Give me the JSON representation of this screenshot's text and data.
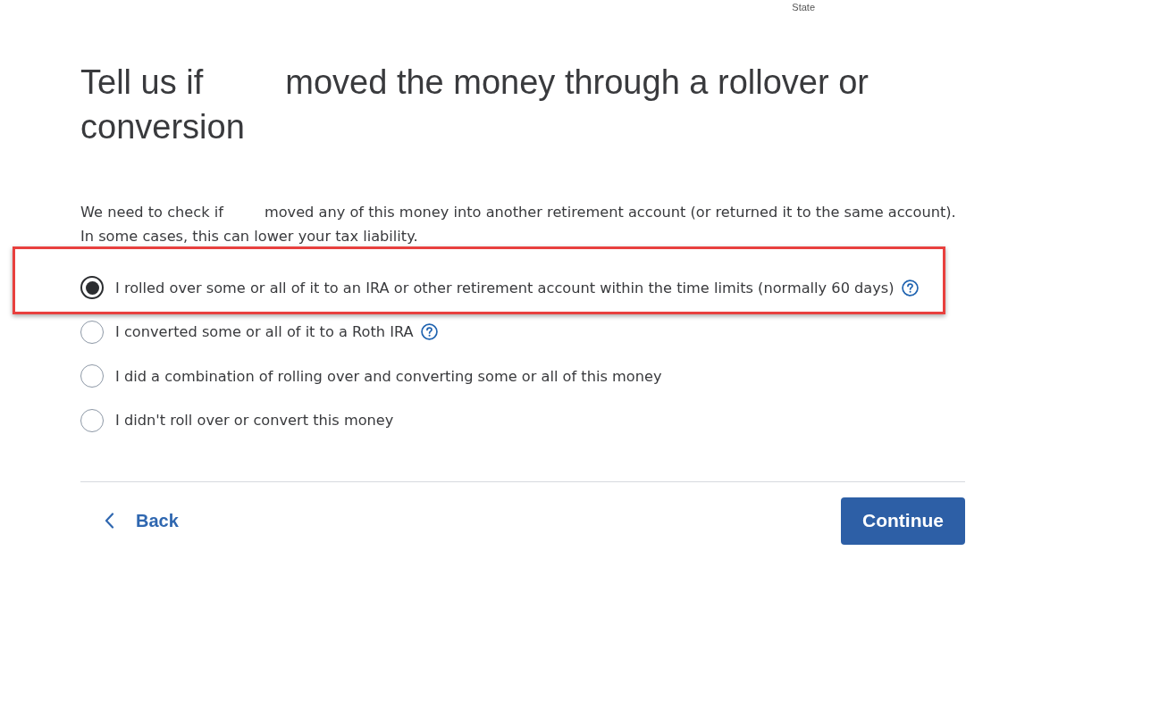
{
  "header": {
    "label": "State"
  },
  "heading": {
    "before_gap": "Tell us if",
    "after_gap": "moved the money through a rollover or conversion"
  },
  "description": {
    "before_gap": "We need to check if",
    "after_gap": "moved any of this money into another retirement account (or returned it to the same account). In some cases, this can lower your tax liability."
  },
  "options": [
    {
      "label": "I rolled over some or all of it to an IRA or other retirement account within the time limits (normally 60 days)",
      "selected": true,
      "help": true,
      "highlighted": true
    },
    {
      "label": "I converted some or all of it to a Roth IRA",
      "selected": false,
      "help": true,
      "highlighted": false
    },
    {
      "label": "I did a combination of rolling over and converting some or all of this money",
      "selected": false,
      "help": false,
      "highlighted": false
    },
    {
      "label": "I didn't roll over or convert this money",
      "selected": false,
      "help": false,
      "highlighted": false
    }
  ],
  "footer": {
    "back": "Back",
    "continue": "Continue"
  }
}
